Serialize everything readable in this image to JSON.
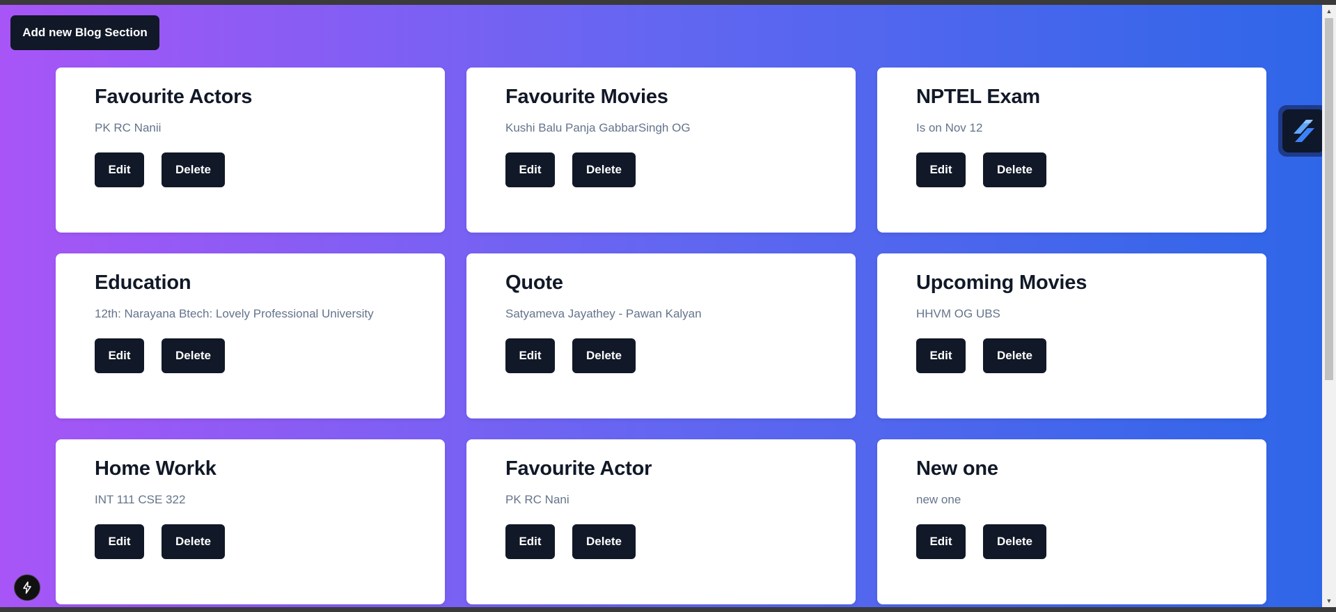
{
  "header": {
    "add_button_label": "Add new Blog Section"
  },
  "cards": [
    {
      "title": "Favourite Actors",
      "description": "PK RC Nanii",
      "edit_label": "Edit",
      "delete_label": "Delete"
    },
    {
      "title": "Favourite Movies",
      "description": "Kushi Balu Panja GabbarSingh OG",
      "edit_label": "Edit",
      "delete_label": "Delete"
    },
    {
      "title": "NPTEL Exam",
      "description": "Is on Nov 12",
      "edit_label": "Edit",
      "delete_label": "Delete"
    },
    {
      "title": "Education",
      "description": "12th: Narayana Btech: Lovely Professional University",
      "edit_label": "Edit",
      "delete_label": "Delete"
    },
    {
      "title": "Quote",
      "description": "Satyameva Jayathey - Pawan Kalyan",
      "edit_label": "Edit",
      "delete_label": "Delete"
    },
    {
      "title": "Upcoming Movies",
      "description": "HHVM OG UBS",
      "edit_label": "Edit",
      "delete_label": "Delete"
    },
    {
      "title": "Home Workk",
      "description": "INT 111 CSE 322",
      "edit_label": "Edit",
      "delete_label": "Delete"
    },
    {
      "title": "Favourite Actor",
      "description": "PK RC Nani",
      "edit_label": "Edit",
      "delete_label": "Delete"
    },
    {
      "title": "New one",
      "description": "new one",
      "edit_label": "Edit",
      "delete_label": "Delete"
    }
  ],
  "colors": {
    "gradient_start": "#a855f7",
    "gradient_mid": "#6366f1",
    "gradient_end": "#2f66e8",
    "button_bg": "#111827",
    "card_bg": "#ffffff",
    "title_color": "#111827",
    "desc_color": "#64748b"
  },
  "icons": {
    "floating_widget": "stacked-slash-logo-icon",
    "dev_badge": "lightning-bolt-icon",
    "scroll_up": "scroll-up-arrow-icon",
    "scroll_down": "scroll-down-arrow-icon"
  }
}
